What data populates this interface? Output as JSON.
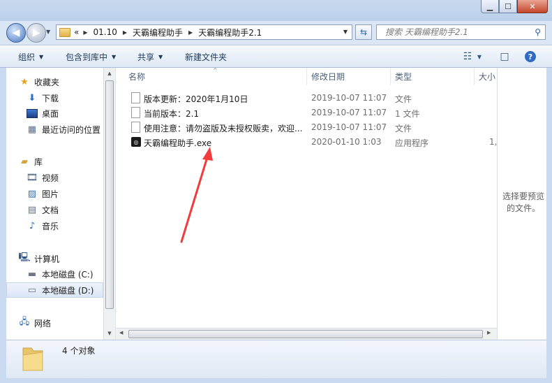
{
  "window": {
    "caption_buttons": [
      {
        "name": "minimize-button",
        "glyph": "▁"
      },
      {
        "name": "maximize-button",
        "glyph": "☐"
      },
      {
        "name": "close-button",
        "glyph": "✕"
      }
    ]
  },
  "address": {
    "overflow": "«",
    "crumbs": [
      "01.10",
      "天霸编程助手",
      "天霸编程助手2.1"
    ]
  },
  "search": {
    "placeholder": "搜索 天霸编程助手2.1"
  },
  "toolbar": {
    "organize": "组织",
    "include_library": "包含到库中",
    "share": "共享",
    "new_folder": "新建文件夹"
  },
  "sidebar": {
    "favorites": "收藏夹",
    "downloads": "下载",
    "desktop": "桌面",
    "recent": "最近访问的位置",
    "libraries": "库",
    "videos": "视频",
    "pictures": "图片",
    "documents": "文档",
    "music": "音乐",
    "computer": "计算机",
    "drive_c": "本地磁盘 (C:)",
    "drive_d": "本地磁盘 (D:)",
    "network": "网络"
  },
  "columns": {
    "name": "名称",
    "date": "修改日期",
    "type": "类型",
    "size": "大小"
  },
  "files": [
    {
      "name": "版本更新：2020年1月10日",
      "date": "2019-10-07 11:07",
      "type": "文件",
      "size": ""
    },
    {
      "name": "当前版本：2.1",
      "date": "2019-10-07 11:07",
      "type": "1 文件",
      "size": ""
    },
    {
      "name": "使用注意：请勿盗版及未授权贩卖，欢迎...",
      "date": "2019-10-07 11:07",
      "type": "文件",
      "size": ""
    },
    {
      "name": "天霸编程助手.exe",
      "date": "2020-01-10 1:03",
      "type": "应用程序",
      "size": "1,"
    }
  ],
  "preview": {
    "message": "选择要预览的文件。"
  },
  "status": {
    "count": "4 个对象"
  },
  "colors": {
    "annotation_arrow": "#f03c3c",
    "accent": "#2c66b5"
  }
}
